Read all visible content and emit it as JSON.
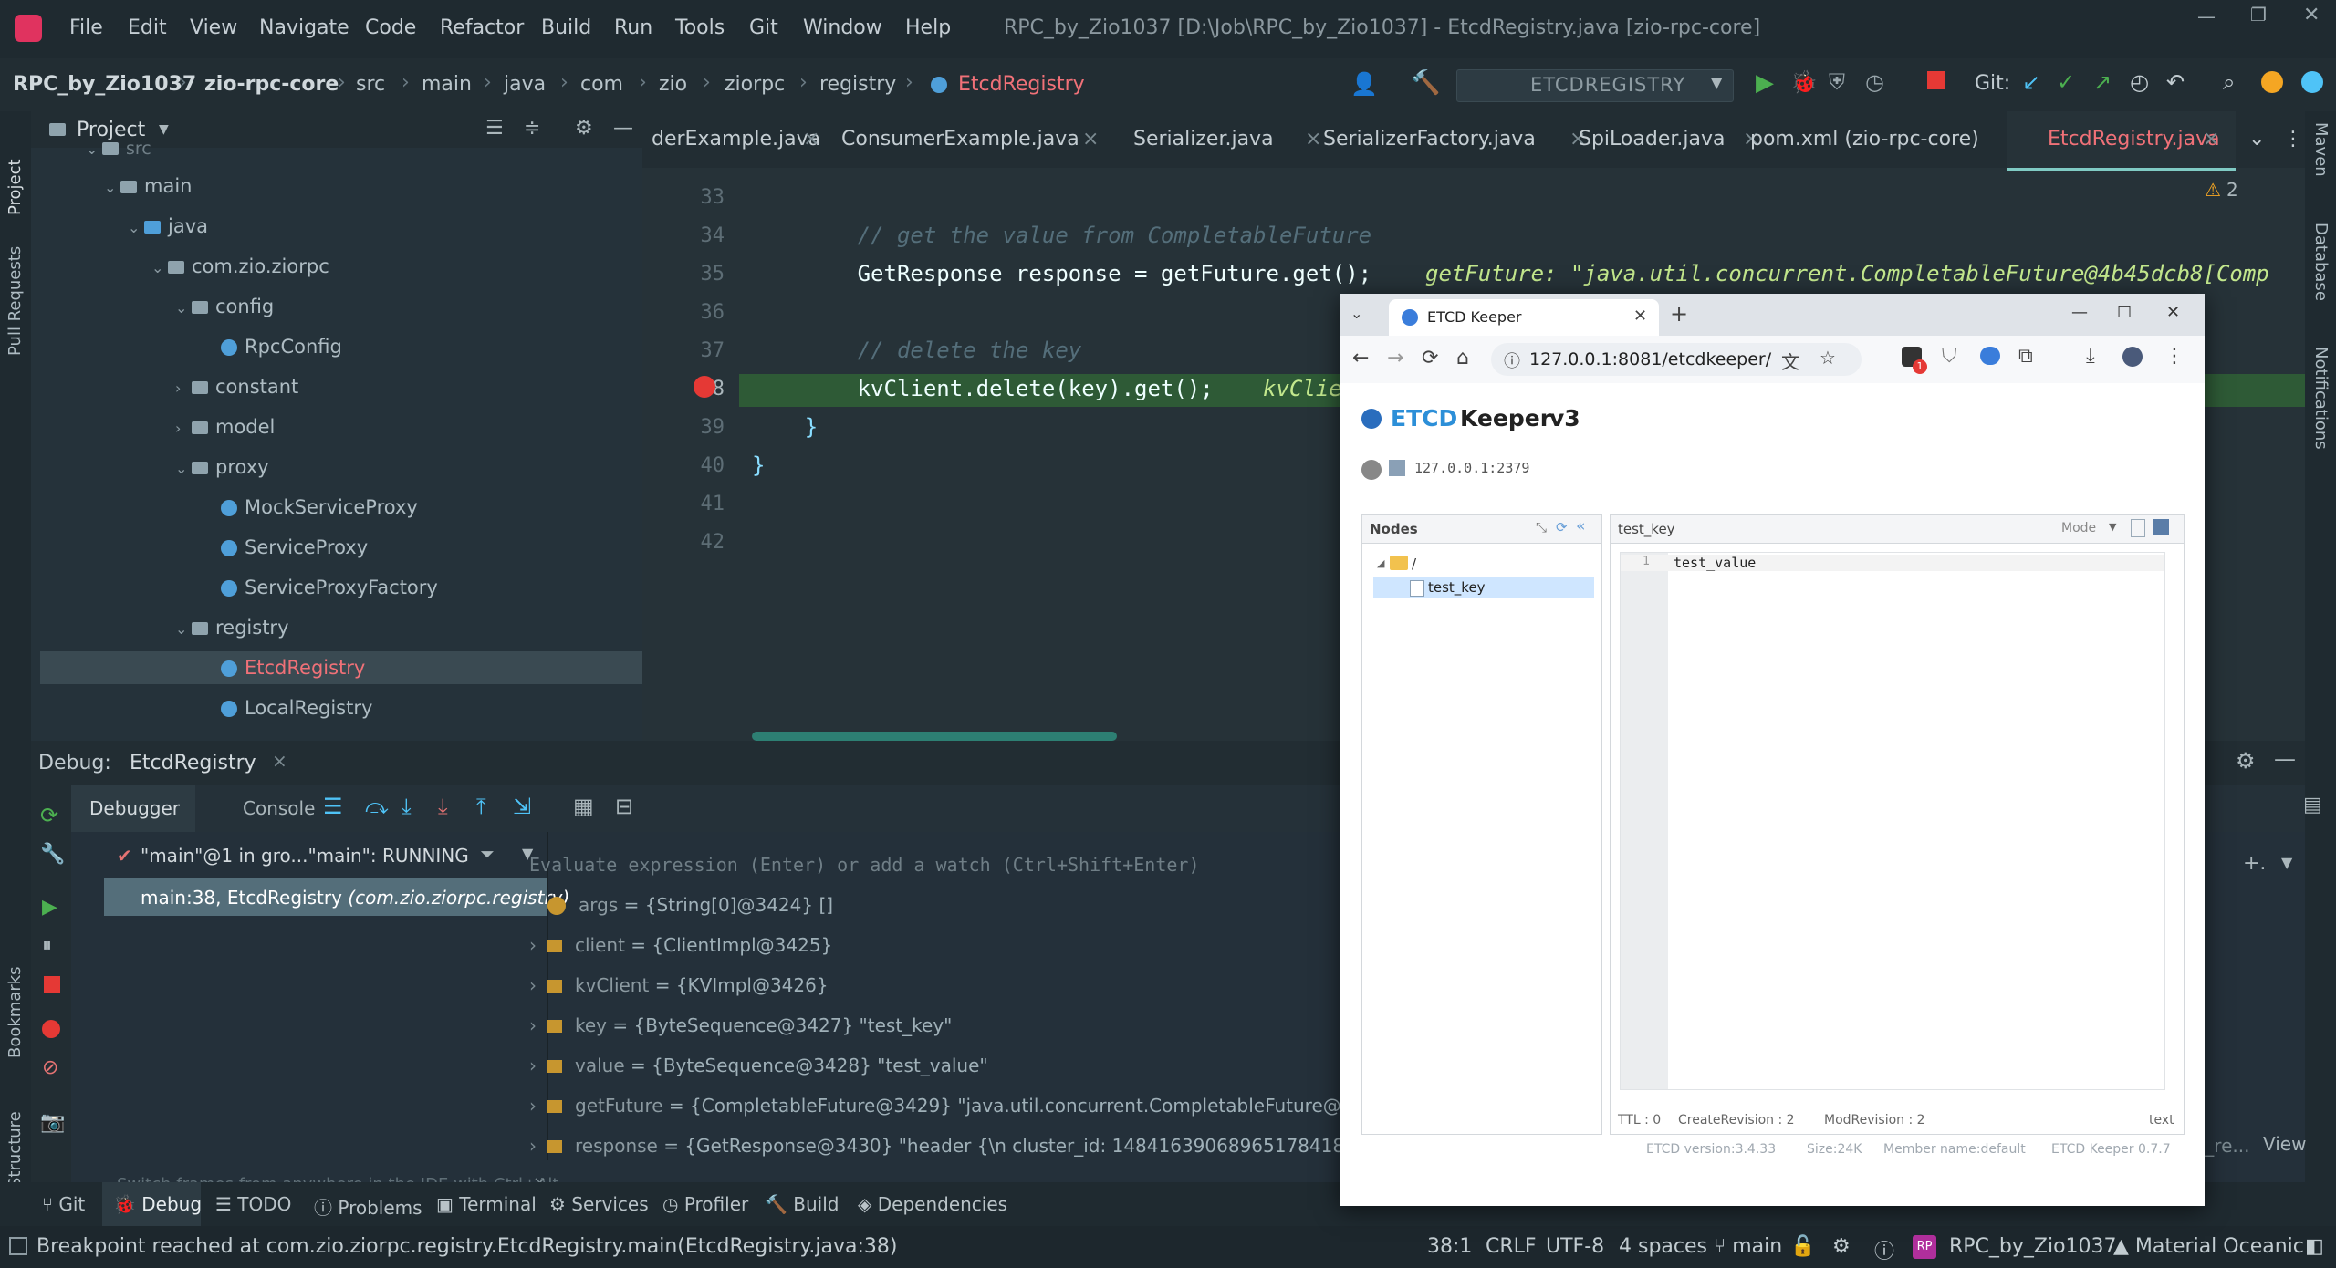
{
  "window": {
    "title": "RPC_by_Zio1037 [D:\\Job\\RPC_by_Zio1037] - EtcdRegistry.java [zio-rpc-core]"
  },
  "menu": [
    "File",
    "Edit",
    "View",
    "Navigate",
    "Code",
    "Refactor",
    "Build",
    "Run",
    "Tools",
    "Git",
    "Window",
    "Help"
  ],
  "breadcrumb": [
    "RPC_by_Zio1037",
    "zio-rpc-core",
    "src",
    "main",
    "java",
    "com",
    "zio",
    "ziorpc",
    "registry",
    "EtcdRegistry"
  ],
  "run_config": "ETCDREGISTRY",
  "git_label": "Git:",
  "project_panel": {
    "title": "Project",
    "tree": [
      {
        "label": "src",
        "type": "folder",
        "depth": 1
      },
      {
        "label": "main",
        "type": "folder",
        "depth": 2
      },
      {
        "label": "java",
        "type": "folder",
        "depth": 3
      },
      {
        "label": "com.zio.ziorpc",
        "type": "folder",
        "depth": 4
      },
      {
        "label": "config",
        "type": "folder",
        "depth": 5
      },
      {
        "label": "RpcConfig",
        "type": "class",
        "depth": 6
      },
      {
        "label": "constant",
        "type": "folder",
        "depth": 5
      },
      {
        "label": "model",
        "type": "folder",
        "depth": 5
      },
      {
        "label": "proxy",
        "type": "folder",
        "depth": 5
      },
      {
        "label": "MockServiceProxy",
        "type": "class",
        "depth": 6
      },
      {
        "label": "ServiceProxy",
        "type": "class",
        "depth": 6
      },
      {
        "label": "ServiceProxyFactory",
        "type": "class",
        "depth": 6
      },
      {
        "label": "registry",
        "type": "folder",
        "depth": 5
      },
      {
        "label": "EtcdRegistry",
        "type": "class",
        "depth": 6,
        "selected": true
      },
      {
        "label": "LocalRegistry",
        "type": "class",
        "depth": 6
      }
    ]
  },
  "editor_tabs": [
    "derExample.java",
    "ConsumerExample.java",
    "Serializer.java",
    "SerializerFactory.java",
    "SpiLoader.java",
    "pom.xml (zio-rpc-core)",
    "EtcdRegistry.java"
  ],
  "warnings_count": "2",
  "code_lines": [
    {
      "n": "33",
      "text": ""
    },
    {
      "n": "34",
      "text": "        // get the value from CompletableFuture",
      "hint": ""
    },
    {
      "n": "35",
      "text": "        GetResponse response = getFuture.get();",
      "hint": "getFuture: \"java.util.concurrent.CompletableFuture@4b45dcb8[Comp"
    },
    {
      "n": "36",
      "text": ""
    },
    {
      "n": "37",
      "text": "        // delete the key"
    },
    {
      "n": "38",
      "text": "        kvClient.delete(key).get();",
      "hint": "kvClie"
    },
    {
      "n": "39",
      "text": "    }"
    },
    {
      "n": "40",
      "text": "}"
    },
    {
      "n": "41",
      "text": ""
    },
    {
      "n": "42",
      "text": ""
    }
  ],
  "debug": {
    "label": "Debug:",
    "session": "EtcdRegistry",
    "tabs": [
      "Debugger",
      "Console"
    ],
    "thread": "\"main\"@1 in gro...\"main\": RUNNING",
    "frame": "main:38, EtcdRegistry",
    "frame_pkg": "(com.zio.ziorpc.registry)",
    "evaluate_placeholder": "Evaluate expression (Enter) or add a watch (Ctrl+Shift+Enter)",
    "hint": "Switch frames from anywhere in the IDE with Ctrl+Alt...",
    "variables": [
      {
        "name": "args",
        "value": "= {String[0]@3424} []"
      },
      {
        "name": "client",
        "value": "= {ClientImpl@3425}"
      },
      {
        "name": "kvClient",
        "value": "= {KVImpl@3426}"
      },
      {
        "name": "key",
        "value": "= {ByteSequence@3427} \"test_key\""
      },
      {
        "name": "value",
        "value": "= {ByteSequence@3428} \"test_value\""
      },
      {
        "name": "getFuture",
        "value": "= {CompletableFuture@3429} \"java.util.concurrent.CompletableFuture@4b45"
      },
      {
        "name": "response",
        "value": "= {GetResponse@3430} \"header {\\n  cluster_id: 14841639068965178418\\n  m"
      }
    ],
    "right_hint": "e_re...",
    "view_label": "View"
  },
  "bottom_tools": [
    "Git",
    "Debug",
    "TODO",
    "Problems",
    "Terminal",
    "Services",
    "Profiler",
    "Build",
    "Dependencies"
  ],
  "side_left": [
    "Project",
    "Pull Requests",
    "Bookmarks",
    "Structure"
  ],
  "side_right": [
    "Maven",
    "Database",
    "Notifications"
  ],
  "status": {
    "message": "Breakpoint reached at com.zio.ziorpc.registry.EtcdRegistry.main(EtcdRegistry.java:38)",
    "position": "38:1",
    "line_sep": "CRLF",
    "encoding": "UTF-8",
    "indent": "4 spaces",
    "branch": "main",
    "project": "RPC_by_Zio1037",
    "project_badge": "RP",
    "theme": "Material Oceanic"
  },
  "browser": {
    "tab_title": "ETCD Keeper",
    "url": "127.0.0.1:8081/etcdkeeper/",
    "ext_badge": "1",
    "app_title_accent": "ETCD",
    "app_title_rest": "Keeper",
    "app_version": "v3",
    "host": "127.0.0.1:2379",
    "nodes_title": "Nodes",
    "tree_root": "/",
    "tree_key": "test_key",
    "key_title": "test_key",
    "mode_label": "Mode",
    "line_no": "1",
    "value": "test_value",
    "ttl": "TTL : 0",
    "create_rev": "CreateRevision : 2",
    "mod_rev": "ModRevision : 2",
    "format": "text",
    "footer": [
      "ETCD version:3.4.33",
      "Size:24K",
      "Member name:default",
      "ETCD Keeper 0.7.7"
    ]
  }
}
